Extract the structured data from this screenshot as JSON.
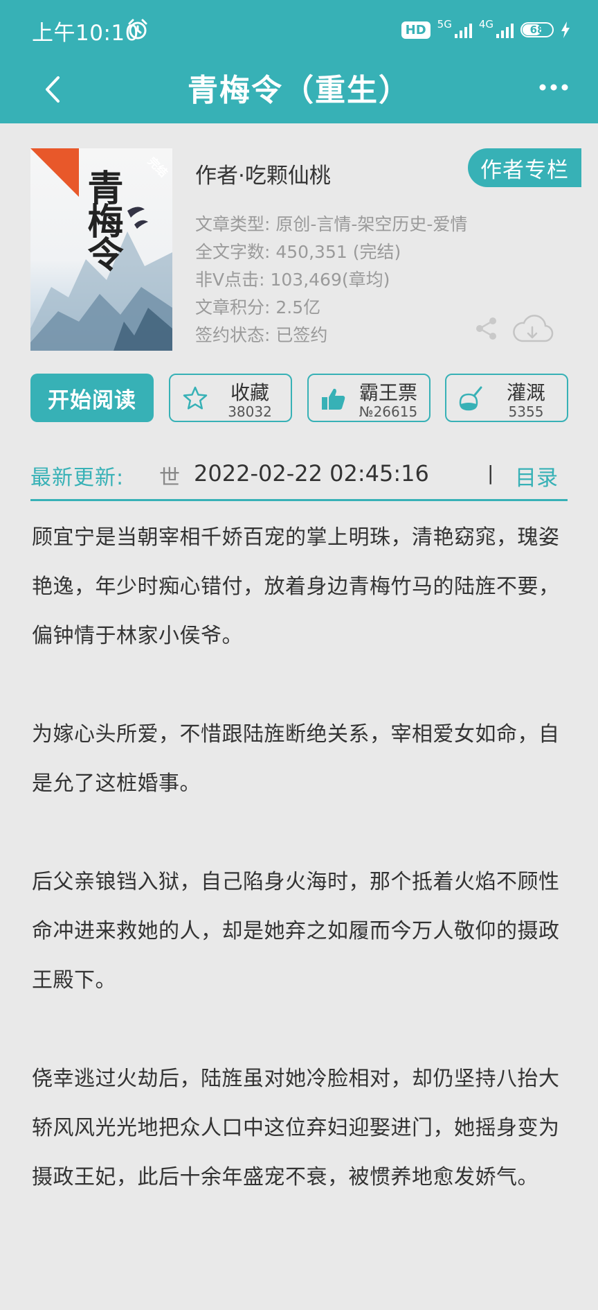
{
  "status_bar": {
    "time": "上午10:10",
    "hd": "HD",
    "net_5g": "5G",
    "net_4g": "4G",
    "battery": "68"
  },
  "nav": {
    "title": "青梅令（重生）"
  },
  "book": {
    "author": "作者·吃颗仙桃",
    "author_button": "作者专栏",
    "cover_badge": "完结",
    "cover_title": "青梅令",
    "meta": [
      "文章类型: 原创-言情-架空历史-爱情",
      "全文字数: 450,351 (完结)",
      "非V点击: 103,469(章均)",
      "文章积分: 2.5亿",
      "签约状态: 已签约"
    ]
  },
  "actions": {
    "read_label": "开始阅读",
    "favorite": {
      "label": "收藏",
      "count": "38032"
    },
    "bawangpiao": {
      "label": "霸王票",
      "count": "№26615"
    },
    "nutrient": {
      "label": "灌溉",
      "count": "5355"
    }
  },
  "update": {
    "label": "最新更新:",
    "char": "世",
    "date": "2022-02-22 02:45:16",
    "separator": "|",
    "toc": "目录"
  },
  "synopsis": [
    "顾宜宁是当朝宰相千娇百宠的掌上明珠，清艳窈窕，瑰姿艳逸，年少时痴心错付，放着身边青梅竹马的陆旌不要，偏钟情于林家小侯爷。",
    "为嫁心头所爱，不惜跟陆旌断绝关系，宰相爱女如命，自是允了这桩婚事。",
    "后父亲锒铛入狱，自己陷身火海时，那个抵着火焰不顾性命冲进来救她的人，却是她弃之如履而今万人敬仰的摄政王殿下。",
    "侥幸逃过火劫后，陆旌虽对她冷脸相对，却仍坚持八抬大轿风风光光地把众人口中这位弃妇迎娶进门，她摇身变为摄政王妃，此后十余年盛宠不衰，被惯养地愈发娇气。"
  ],
  "colors": {
    "accent": "#37b1b6",
    "background": "#e9e9e9",
    "cover_ribbon": "#e8582a"
  }
}
